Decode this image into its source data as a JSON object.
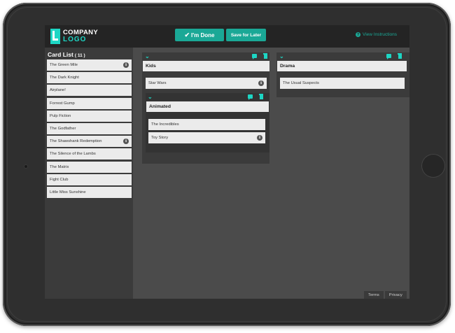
{
  "header": {
    "logo_line1": "COMPANY",
    "logo_line2": "LOGO",
    "done_label": "I'm Done",
    "save_label": "Save for Later",
    "instructions_label": "View Instructions"
  },
  "sidebar": {
    "title": "Card List",
    "count": "( 11 )",
    "cards": [
      {
        "label": "The Green Mile",
        "has_info": true
      },
      {
        "label": "The Dark Knight",
        "has_info": false
      },
      {
        "label": "Airplane!",
        "has_info": false
      },
      {
        "label": "Forrest Gump",
        "has_info": false
      },
      {
        "label": "Pulp Fiction",
        "has_info": false
      },
      {
        "label": "The Godfather",
        "has_info": false
      },
      {
        "label": "The Shawshank Redemption",
        "has_info": true
      },
      {
        "label": "The Silence of the Lambs",
        "has_info": false
      },
      {
        "label": "The Matrix",
        "has_info": false
      },
      {
        "label": "Fight Club",
        "has_info": false
      },
      {
        "label": "Little Miss Sunshine",
        "has_info": false
      }
    ]
  },
  "groups": {
    "kids": {
      "title": "Kids",
      "cards": [
        {
          "label": "Star Wars",
          "has_info": true
        }
      ],
      "subgroup": {
        "title": "Animated",
        "cards": [
          {
            "label": "The Incredibles",
            "has_info": false
          },
          {
            "label": "Toy Story",
            "has_info": true
          }
        ]
      }
    },
    "drama": {
      "title": "Drama",
      "cards": [
        {
          "label": "The Usual Suspects",
          "has_info": false
        }
      ]
    }
  },
  "footer": {
    "terms": "Terms",
    "privacy": "Privacy"
  },
  "colors": {
    "accent": "#1dd6c4",
    "button": "#1aa896",
    "topbar": "#242424",
    "sidebar": "#3b3b3b",
    "board": "#4b4b4b",
    "card": "#ebebeb"
  },
  "icons": {
    "info": "info-icon",
    "chat": "chat-icon",
    "trash": "trash-icon",
    "collapse": "chevron-down-icon",
    "check": "check-icon",
    "help": "help-icon"
  }
}
